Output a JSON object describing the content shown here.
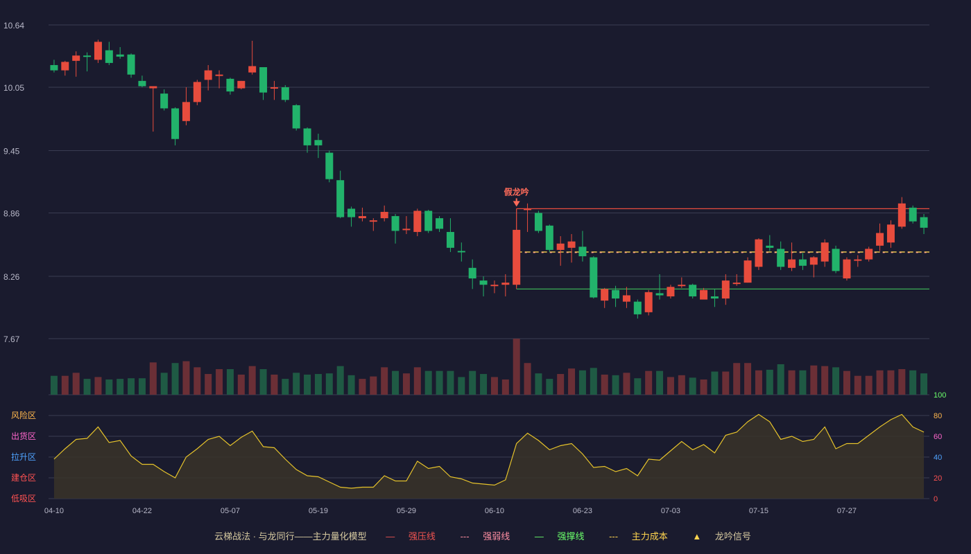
{
  "colors": {
    "bg": "#1a1b2e",
    "up": "#e84c3d",
    "down": "#22b36b",
    "vol_up": "#6b2f36",
    "vol_down": "#1f5a44",
    "grid": "#3a3c52",
    "press": "#e84c3d",
    "support": "#3fbf5a",
    "cost": "#ffd54f",
    "osc_line": "#e6c32b",
    "osc_fill": "#3a3328"
  },
  "chart_data": {
    "type": "candlestick",
    "y_ticks": [
      "10.64",
      "10.05",
      "9.45",
      "8.86",
      "8.26",
      "7.67"
    ],
    "ylim": [
      7.67,
      10.64
    ],
    "x_ticks": [
      "04-10",
      "04-22",
      "05-07",
      "05-19",
      "05-29",
      "06-10",
      "06-23",
      "07-03",
      "07-15",
      "07-27"
    ],
    "x_tick_index": [
      0,
      8,
      16,
      24,
      32,
      40,
      48,
      56,
      64,
      72
    ],
    "candles": [
      [
        10.26,
        10.21,
        10.31,
        10.19
      ],
      [
        10.21,
        10.29,
        10.3,
        10.16
      ],
      [
        10.3,
        10.35,
        10.39,
        10.15
      ],
      [
        10.35,
        10.34,
        10.38,
        10.2
      ],
      [
        10.31,
        10.48,
        10.5,
        10.28
      ],
      [
        10.4,
        10.28,
        10.48,
        10.26
      ],
      [
        10.36,
        10.34,
        10.43,
        10.32
      ],
      [
        10.36,
        10.17,
        10.37,
        10.14
      ],
      [
        10.11,
        10.06,
        10.16,
        10.05
      ],
      [
        10.04,
        10.06,
        10.06,
        9.63
      ],
      [
        9.99,
        9.85,
        10.03,
        9.83
      ],
      [
        9.85,
        9.56,
        9.86,
        9.5
      ],
      [
        9.73,
        9.91,
        10.05,
        9.69
      ],
      [
        9.91,
        10.1,
        10.12,
        9.88
      ],
      [
        10.12,
        10.21,
        10.26,
        10.02
      ],
      [
        10.17,
        10.17,
        10.21,
        10.04
      ],
      [
        10.13,
        10.01,
        10.14,
        9.98
      ],
      [
        10.04,
        10.11,
        10.11,
        10.03
      ],
      [
        10.19,
        10.25,
        10.49,
        10.17
      ],
      [
        10.24,
        10.0,
        10.24,
        9.93
      ],
      [
        10.05,
        10.05,
        10.11,
        9.93
      ],
      [
        10.05,
        9.93,
        10.07,
        9.91
      ],
      [
        9.88,
        9.66,
        9.89,
        9.64
      ],
      [
        9.66,
        9.5,
        9.67,
        9.43
      ],
      [
        9.55,
        9.5,
        9.61,
        9.38
      ],
      [
        9.43,
        9.18,
        9.45,
        9.15
      ],
      [
        9.17,
        8.82,
        9.26,
        8.81
      ],
      [
        8.9,
        8.82,
        8.92,
        8.73
      ],
      [
        8.81,
        8.83,
        8.91,
        8.78
      ],
      [
        8.79,
        8.79,
        8.81,
        8.69
      ],
      [
        8.81,
        8.87,
        8.93,
        8.78
      ],
      [
        8.83,
        8.69,
        8.85,
        8.57
      ],
      [
        8.7,
        8.71,
        8.83,
        8.66
      ],
      [
        8.68,
        8.88,
        8.9,
        8.64
      ],
      [
        8.88,
        8.69,
        8.89,
        8.67
      ],
      [
        8.81,
        8.71,
        8.83,
        8.68
      ],
      [
        8.68,
        8.53,
        8.81,
        8.49
      ],
      [
        8.5,
        8.49,
        8.58,
        8.4
      ],
      [
        8.34,
        8.24,
        8.42,
        8.14
      ],
      [
        8.22,
        8.18,
        8.26,
        8.07
      ],
      [
        8.18,
        8.18,
        8.22,
        8.1
      ],
      [
        8.18,
        8.2,
        8.28,
        8.07
      ],
      [
        8.18,
        8.7,
        8.9,
        8.16
      ],
      [
        8.9,
        8.9,
        8.95,
        8.68
      ],
      [
        8.86,
        8.69,
        8.88,
        8.67
      ],
      [
        8.74,
        8.51,
        8.75,
        8.49
      ],
      [
        8.51,
        8.57,
        8.64,
        8.36
      ],
      [
        8.53,
        8.59,
        8.66,
        8.39
      ],
      [
        8.54,
        8.45,
        8.69,
        8.4
      ],
      [
        8.44,
        8.06,
        8.45,
        8.05
      ],
      [
        8.03,
        8.14,
        8.15,
        7.96
      ],
      [
        8.13,
        8.05,
        8.17,
        7.97
      ],
      [
        8.02,
        8.08,
        8.16,
        7.96
      ],
      [
        8.02,
        7.9,
        8.04,
        7.86
      ],
      [
        7.92,
        8.11,
        8.13,
        7.89
      ],
      [
        8.1,
        8.08,
        8.28,
        8.04
      ],
      [
        8.07,
        8.16,
        8.18,
        8.05
      ],
      [
        8.18,
        8.18,
        8.25,
        8.15
      ],
      [
        8.18,
        8.07,
        8.19,
        8.05
      ],
      [
        8.04,
        8.13,
        8.15,
        8.05
      ],
      [
        8.07,
        8.05,
        8.14,
        7.97
      ],
      [
        8.05,
        8.22,
        8.28,
        7.99
      ],
      [
        8.2,
        8.2,
        8.28,
        8.17
      ],
      [
        8.2,
        8.41,
        8.44,
        8.2
      ],
      [
        8.35,
        8.61,
        8.62,
        8.32
      ],
      [
        8.55,
        8.53,
        8.65,
        8.5
      ],
      [
        8.52,
        8.35,
        8.59,
        8.32
      ],
      [
        8.34,
        8.42,
        8.58,
        8.31
      ],
      [
        8.42,
        8.36,
        8.48,
        8.32
      ],
      [
        8.37,
        8.44,
        8.45,
        8.25
      ],
      [
        8.4,
        8.58,
        8.61,
        8.35
      ],
      [
        8.52,
        8.31,
        8.55,
        8.29
      ],
      [
        8.24,
        8.42,
        8.44,
        8.22
      ],
      [
        8.42,
        8.42,
        8.46,
        8.35
      ],
      [
        8.42,
        8.52,
        8.54,
        8.4
      ],
      [
        8.55,
        8.67,
        8.76,
        8.5
      ],
      [
        8.58,
        8.75,
        8.79,
        8.53
      ],
      [
        8.73,
        8.95,
        9.01,
        8.71
      ],
      [
        8.91,
        8.78,
        8.93,
        8.76
      ],
      [
        8.82,
        8.72,
        8.85,
        8.66
      ]
    ],
    "volume": [
      31,
      31,
      36,
      26,
      29,
      25,
      26,
      27,
      27,
      53,
      36,
      52,
      55,
      45,
      34,
      42,
      42,
      33,
      47,
      42,
      33,
      26,
      36,
      33,
      34,
      35,
      47,
      32,
      26,
      30,
      45,
      39,
      35,
      45,
      39,
      39,
      39,
      29,
      39,
      34,
      29,
      25,
      92,
      52,
      35,
      26,
      34,
      43,
      40,
      44,
      33,
      32,
      36,
      27,
      39,
      39,
      29,
      32,
      28,
      25,
      38,
      38,
      52,
      52,
      40,
      41,
      50,
      40,
      40,
      48,
      47,
      45,
      39,
      31,
      31,
      40,
      40,
      42,
      40,
      35
    ],
    "vol_ylim": [
      0,
      92
    ],
    "osc": [
      38,
      48,
      57,
      58,
      69,
      54,
      56,
      41,
      33,
      33,
      26,
      20,
      40,
      48,
      57,
      60,
      51,
      59,
      65,
      50,
      49,
      38,
      28,
      22,
      21,
      16,
      11,
      10,
      11,
      11,
      22,
      17,
      17,
      36,
      29,
      31,
      21,
      19,
      15,
      14,
      13,
      18,
      53,
      63,
      56,
      47,
      51,
      53,
      43,
      30,
      31,
      26,
      29,
      22,
      38,
      37,
      46,
      55,
      47,
      52,
      44,
      61,
      64,
      74,
      81,
      74,
      57,
      60,
      55,
      57,
      69,
      48,
      53,
      53,
      61,
      69,
      76,
      81,
      69,
      64
    ],
    "osc_ticks": [
      "100",
      "80",
      "60",
      "40",
      "20",
      "0"
    ],
    "osc_tick_colors": [
      "#6bff6b",
      "#ffb74d",
      "#ff66cc",
      "#4fa3ff",
      "#ff5252",
      "#ff5252"
    ],
    "zones": [
      "风险区",
      "出货区",
      "拉升区",
      "建仓区",
      "低吸区"
    ],
    "zone_colors": [
      "#ffb74d",
      "#ff66cc",
      "#4fa3ff",
      "#ff5252",
      "#ff5252"
    ],
    "lines": {
      "strong_press": 8.9,
      "strong_support": 8.14,
      "main_cost": 8.49,
      "start_index": 42
    },
    "signal": {
      "label": "假龙吟",
      "index": 42
    }
  },
  "legend": {
    "title": "云梯战法 · 与龙同行——主力量化模型",
    "items": [
      {
        "label": "强压线",
        "cls": "lg-red",
        "glyph": "—"
      },
      {
        "label": "强弱线",
        "cls": "lg-pink",
        "glyph": "---"
      },
      {
        "label": "强撑线",
        "cls": "lg-green",
        "glyph": "—"
      },
      {
        "label": "主力成本",
        "cls": "lg-yellow",
        "glyph": "---"
      },
      {
        "label": "龙吟信号",
        "cls": "lg-yellow",
        "glyph": "▲"
      }
    ]
  }
}
